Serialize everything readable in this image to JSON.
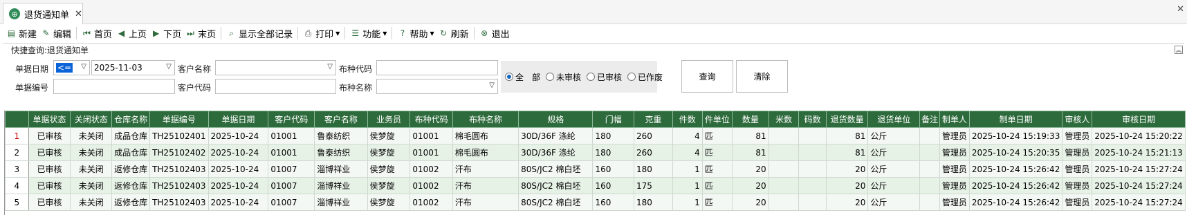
{
  "tab": {
    "title": "退货通知单",
    "icon": "globe-icon"
  },
  "toolbar": {
    "items": [
      {
        "label": "新建",
        "icon": "new-doc-icon"
      },
      {
        "label": "编辑",
        "icon": "edit-icon"
      },
      {
        "label": "首页",
        "icon": "first-page-icon"
      },
      {
        "label": "上页",
        "icon": "prev-page-icon"
      },
      {
        "label": "下页",
        "icon": "next-page-icon"
      },
      {
        "label": "末页",
        "icon": "last-page-icon"
      },
      {
        "label": "显示全部记录",
        "icon": "show-all-icon"
      },
      {
        "label": "打印",
        "icon": "print-icon"
      },
      {
        "label": "功能",
        "icon": "list-icon"
      },
      {
        "label": "帮助",
        "icon": "help-icon"
      },
      {
        "label": "刷新",
        "icon": "refresh-icon"
      },
      {
        "label": "退出",
        "icon": "exit-icon"
      }
    ]
  },
  "query": {
    "title": "快捷查询:退货通知单",
    "date_label": "单据日期",
    "date_operator": "<=",
    "date_value": "2025-11-03",
    "customer_name_label": "客户名称",
    "customer_name_value": "",
    "fabric_code_label": "布种代码",
    "fabric_code_value": "",
    "doc_no_label": "单据编号",
    "doc_no_value": "",
    "customer_code_label": "客户代码",
    "customer_code_value": "",
    "fabric_name_label": "布种名称",
    "fabric_name_value": "",
    "status_options": [
      "全　部",
      "未审核",
      "已审核",
      "已作废"
    ],
    "status_selected": 0,
    "search_button": "查询",
    "clear_button": "清除"
  },
  "grid": {
    "columns": [
      "单据状态",
      "关闭状态",
      "仓库名称",
      "单据编号",
      "单据日期",
      "客户代码",
      "客户名称",
      "业务员",
      "布种代码",
      "布种名称",
      "规格",
      "门幅",
      "克重",
      "件数",
      "件单位",
      "数量",
      "米数",
      "码数",
      "退货数量",
      "退货单位",
      "备注",
      "制单人",
      "制单日期",
      "审核人",
      "审核日期"
    ],
    "rows": [
      [
        "1",
        "已审核",
        "未关闭",
        "成品仓库",
        "TH25102401",
        "2025-10-24",
        "01001",
        "鲁泰纺织",
        "侯梦旋",
        "01001",
        "棉毛圆布",
        "30D/36F 涤纶",
        "180",
        "260",
        "4",
        "匹",
        "81",
        "",
        "",
        "81",
        "公斤",
        "",
        "管理员",
        "2025-10-24 15:19:33",
        "管理员",
        "2025-10-24 15:20:22"
      ],
      [
        "2",
        "已审核",
        "未关闭",
        "成品仓库",
        "TH25102402",
        "2025-10-24",
        "01001",
        "鲁泰纺织",
        "侯梦旋",
        "01001",
        "棉毛圆布",
        "30D/36F 涤纶",
        "180",
        "260",
        "4",
        "匹",
        "81",
        "",
        "",
        "81",
        "公斤",
        "",
        "管理员",
        "2025-10-24 15:20:35",
        "管理员",
        "2025-10-24 15:21:13"
      ],
      [
        "3",
        "已审核",
        "未关闭",
        "返修仓库",
        "TH25102403",
        "2025-10-24",
        "01007",
        "淄博祥业",
        "侯梦旋",
        "01002",
        "汗布",
        "80S/JC2 棉白坯",
        "160",
        "180",
        "1",
        "匹",
        "20",
        "",
        "",
        "20",
        "公斤",
        "",
        "管理员",
        "2025-10-24 15:26:42",
        "管理员",
        "2025-10-24 15:27:24"
      ],
      [
        "4",
        "已审核",
        "未关闭",
        "返修仓库",
        "TH25102403",
        "2025-10-24",
        "01007",
        "淄博祥业",
        "侯梦旋",
        "01002",
        "汗布",
        "80S/JC2 棉白坯",
        "160",
        "175",
        "1",
        "匹",
        "20",
        "",
        "",
        "20",
        "公斤",
        "",
        "管理员",
        "2025-10-24 15:26:42",
        "管理员",
        "2025-10-24 15:27:24"
      ],
      [
        "5",
        "已审核",
        "未关闭",
        "返修仓库",
        "TH25102403",
        "2025-10-24",
        "01007",
        "淄博祥业",
        "侯梦旋",
        "01002",
        "汗布",
        "80S/JC2 棉白坯",
        "160",
        "180",
        "1",
        "匹",
        "20",
        "",
        "",
        "20",
        "公斤",
        "",
        "管理员",
        "2025-10-24 15:26:42",
        "管理员",
        "2025-10-24 15:27:24"
      ]
    ]
  },
  "colors": {
    "header_bg": "#2e6b3c",
    "row_even": "#e7f2e7",
    "row_odd": "#f4f8f4",
    "active_rownum": "#cc0000",
    "radio_on": "#1565c0",
    "operator_bg": "#0a64d8"
  }
}
